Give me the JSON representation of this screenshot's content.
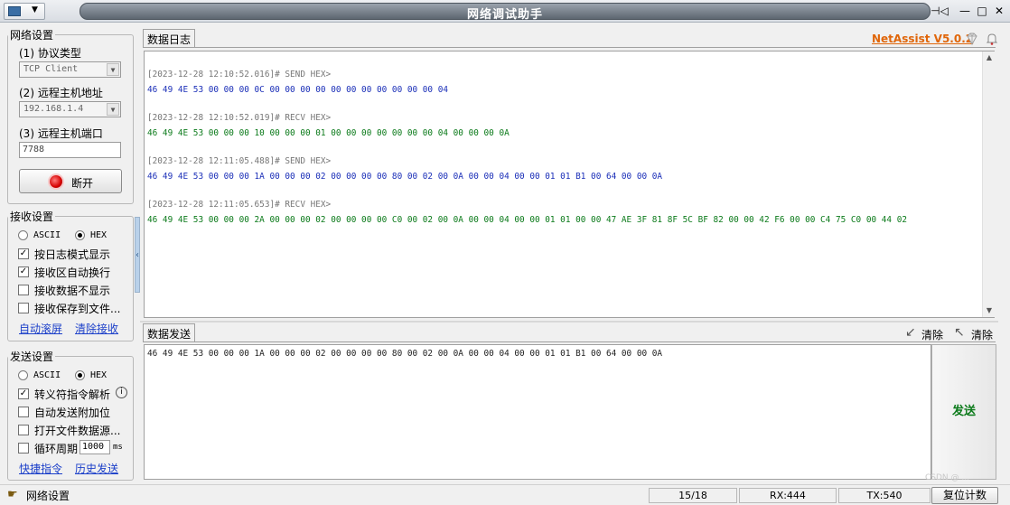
{
  "window": {
    "title": "网络调试助手",
    "buttons": {
      "pin": "⊣◁",
      "minimize": "—",
      "maximize": "□",
      "close": "✕"
    }
  },
  "network_settings": {
    "legend": "网络设置",
    "protocol_label": "(1) 协议类型",
    "protocol_value": "TCP Client",
    "remote_host_label": "(2) 远程主机地址",
    "remote_host_value": "192.168.1.4",
    "remote_port_label": "(3) 远程主机端口",
    "remote_port_value": "7788",
    "disconnect_label": "断开"
  },
  "receive_settings": {
    "legend": "接收设置",
    "ascii_label": "ASCII",
    "hex_label": "HEX",
    "mode": "HEX",
    "options": [
      {
        "label": "按日志模式显示",
        "checked": true
      },
      {
        "label": "接收区自动换行",
        "checked": true
      },
      {
        "label": "接收数据不显示",
        "checked": false
      },
      {
        "label": "接收保存到文件...",
        "checked": false
      }
    ],
    "link_autoscroll": "自动滚屏",
    "link_clear": "清除接收"
  },
  "send_settings": {
    "legend": "发送设置",
    "ascii_label": "ASCII",
    "hex_label": "HEX",
    "mode": "HEX",
    "options": [
      {
        "label": "转义符指令解析",
        "checked": true
      },
      {
        "label": "自动发送附加位",
        "checked": false
      },
      {
        "label": "打开文件数据源...",
        "checked": false
      },
      {
        "label": "循环周期",
        "checked": false
      }
    ],
    "cycle_value": "1000",
    "cycle_unit": "ms",
    "link_shortcuts": "快捷指令",
    "link_history": "历史发送"
  },
  "log": {
    "tab_label": "数据日志",
    "brand": "NetAssist V5.0.2",
    "entries": [
      {
        "header": "[2023-12-28 12:10:52.016]# SEND HEX>",
        "data": "46 49 4E 53 00 00 00 0C 00 00 00 00 00 00 00 00 00 00 00 04",
        "kind": "send"
      },
      {
        "header": "[2023-12-28 12:10:52.019]# RECV HEX>",
        "data": "46 49 4E 53 00 00 00 10 00 00 00 01 00 00 00 00 00 00 00 04 00 00 00 0A",
        "kind": "recv"
      },
      {
        "header": "[2023-12-28 12:11:05.488]# SEND HEX>",
        "data": "46 49 4E 53 00 00 00 1A 00 00 00 02 00 00 00 00 80 00 02 00 0A 00 00 04 00 00 01 01 B1 00 64 00 00 0A",
        "kind": "send"
      },
      {
        "header": "[2023-12-28 12:11:05.653]# RECV HEX>",
        "data": "46 49 4E 53 00 00 00 2A 00 00 00 02 00 00 00 00 C0 00 02 00 0A 00 00 04 00 00 01 01 00 00 47 AE 3F 81 8F 5C BF 82 00 00 42 F6 00 00 C4 75 C0 00 44 02",
        "kind": "recv"
      }
    ]
  },
  "send": {
    "tab_label": "数据发送",
    "clear1_label": "清除",
    "clear2_label": "清除",
    "content": "46 49 4E 53 00 00 00 1A 00 00 00 02 00 00 00 00 80 00 02 00 0A 00 00 04 00 00 01 01 B1 00 64 00 00 0A",
    "send_button": "发送"
  },
  "status": {
    "mode": "网络设置",
    "count": "15/18",
    "rx": "RX:444",
    "tx": "TX:540",
    "reset_label": "复位计数",
    "watermark": "CSDN @ ..."
  }
}
